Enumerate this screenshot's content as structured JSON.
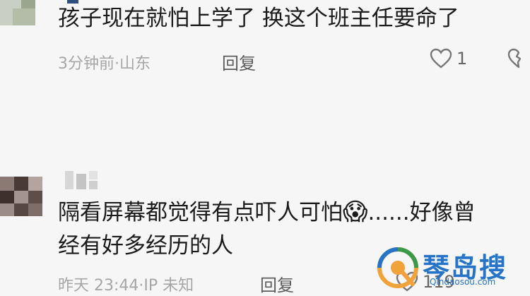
{
  "comments": [
    {
      "text": "孩子现在就怕上学了 换这个班主任要命了",
      "time": "3分钟前",
      "location": "山东",
      "sep": "·",
      "reply_label": "回复",
      "likes": "1"
    },
    {
      "text_line1": "隔看屏幕都觉得有点吓人可怕",
      "emoji": "😱",
      "text_line1_tail": "......好像曾",
      "text_line2": "经有好多经历的人",
      "time": "昨天 23:44",
      "location": "IP 未知",
      "sep": "·",
      "reply_label": "回复",
      "likes": "119"
    }
  ],
  "icons": [
    "heart-icon",
    "broken-heart-icon",
    "avatar-mosaic",
    "watermark-logo"
  ],
  "colors": {
    "background": "#f6f6f6",
    "text": "#1b1b1b",
    "meta": "#a6a6a6",
    "watermark": "#2574c7"
  },
  "watermark": {
    "name": "琴岛搜",
    "url": "Qindaosou.com"
  }
}
